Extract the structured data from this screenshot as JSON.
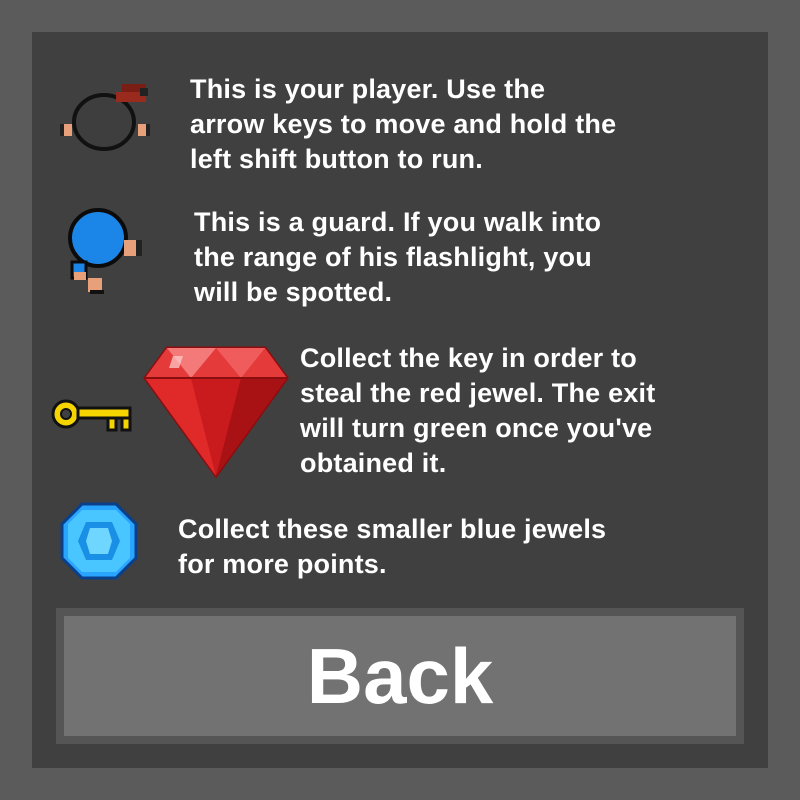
{
  "instructions": {
    "player": {
      "icon": "player-icon",
      "lines": [
        "This is your player. Use the",
        "arrow keys to move and hold the",
        "left shift button to run."
      ]
    },
    "guard": {
      "icon": "guard-icon",
      "lines": [
        "This is a guard. If you walk into",
        "the range of his flashlight, you",
        "will be spotted."
      ]
    },
    "key_jewel": {
      "icons": [
        "key-icon",
        "red-jewel-icon"
      ],
      "lines": [
        "Collect the key in order to",
        "steal the red jewel. The exit",
        "will turn green once you've",
        "obtained it."
      ]
    },
    "blue_jewel": {
      "icon": "blue-jewel-icon",
      "lines": [
        "Collect these smaller blue jewels",
        "for more points."
      ]
    }
  },
  "back_button": {
    "label": "Back"
  },
  "colors": {
    "outer_background": "#5b5b5b",
    "panel": "#404040",
    "button_frame": "#555555",
    "button": "#727272",
    "text": "#ffffff",
    "player_hair": "#9b2a1e",
    "guard_blue": "#1c86e8",
    "key_yellow": "#f5d400",
    "red_jewel": "#d81e1e",
    "blue_jewel": "#2aa5ff"
  }
}
